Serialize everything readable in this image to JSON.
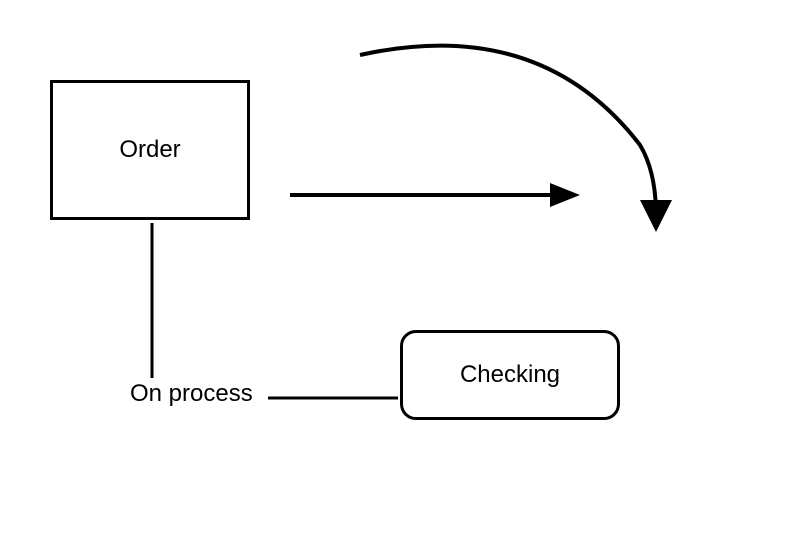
{
  "nodes": {
    "order": {
      "label": "Order"
    },
    "checking": {
      "label": "Checking"
    },
    "on_process": {
      "label": "On process"
    }
  }
}
